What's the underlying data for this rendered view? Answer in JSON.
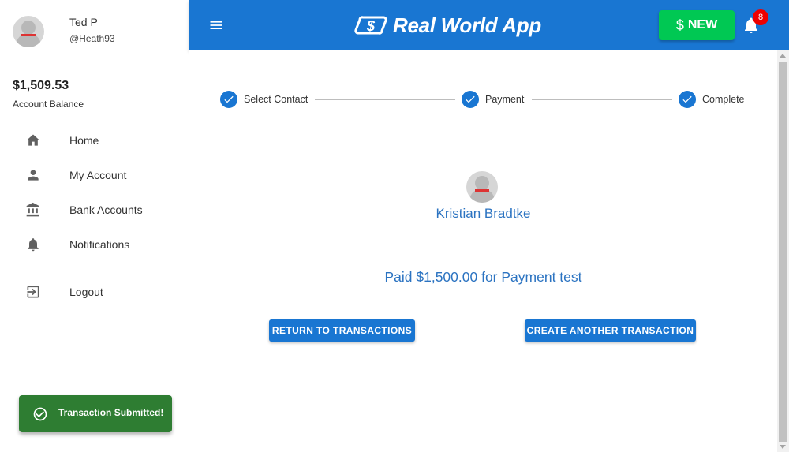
{
  "user": {
    "name": "Ted P",
    "handle": "@Heath93",
    "balance": "$1,509.53",
    "balance_label": "Account Balance"
  },
  "nav": {
    "items": [
      {
        "label": "Home",
        "icon": "home-icon"
      },
      {
        "label": "My Account",
        "icon": "person-icon"
      },
      {
        "label": "Bank Accounts",
        "icon": "bank-icon"
      },
      {
        "label": "Notifications",
        "icon": "bell-icon"
      },
      {
        "label": "Logout",
        "icon": "logout-icon"
      }
    ]
  },
  "header": {
    "app_title": "Real World App",
    "new_label": "NEW",
    "new_icon": "$",
    "notification_count": "8"
  },
  "stepper": {
    "steps": [
      "Select Contact",
      "Payment",
      "Complete"
    ]
  },
  "transaction": {
    "contact_name": "Kristian Bradtke",
    "summary": "Paid $1,500.00 for Payment test",
    "return_label": "RETURN TO TRANSACTIONS",
    "create_label": "CREATE ANOTHER TRANSACTION"
  },
  "snackbar": {
    "message": "Transaction Submitted!"
  },
  "colors": {
    "primary": "#1976d2",
    "new_button": "#00c853",
    "snackbar": "#2e7d32",
    "badge": "#e00000",
    "link_text": "#2b73c1"
  }
}
